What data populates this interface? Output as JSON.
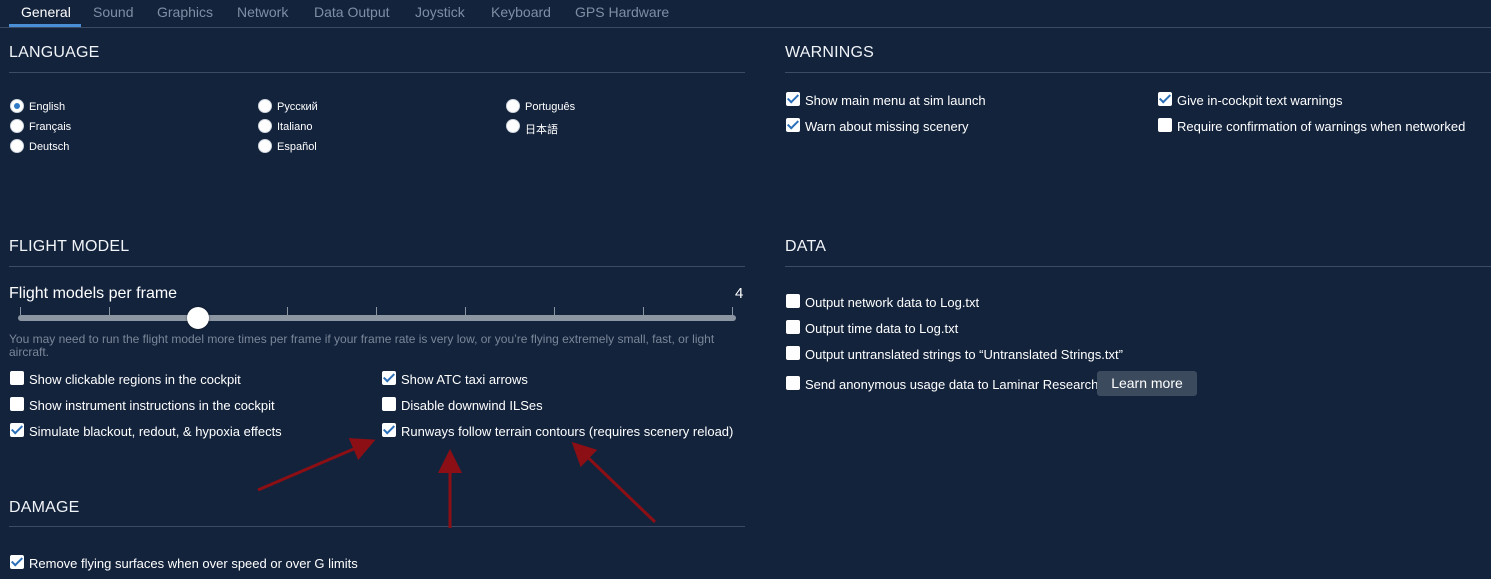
{
  "tabs": [
    "General",
    "Sound",
    "Graphics",
    "Network",
    "Data Output",
    "Joystick",
    "Keyboard",
    "GPS Hardware"
  ],
  "active_tab": "General",
  "language": {
    "title": "LANGUAGE",
    "options": [
      "English",
      "Français",
      "Deutsch",
      "Русский",
      "Italiano",
      "Español",
      "Português",
      "日本語"
    ],
    "selected": "English"
  },
  "warnings": {
    "title": "WARNINGS",
    "items": [
      {
        "label": "Show main menu at sim launch",
        "checked": true
      },
      {
        "label": "Warn about missing scenery",
        "checked": true
      },
      {
        "label": "Give in-cockpit text warnings",
        "checked": true
      },
      {
        "label": "Require confirmation of warnings when networked",
        "checked": false
      }
    ]
  },
  "flight_model": {
    "title": "FLIGHT MODEL",
    "slider_label": "Flight models per frame",
    "slider_value": "4",
    "slider_fraction": 0.25,
    "hint": "You may need to run the flight model more times per frame if your frame rate is very low, or you’re flying extremely small, fast, or light aircraft.",
    "items": [
      {
        "label": "Show clickable regions in the cockpit",
        "checked": false
      },
      {
        "label": "Show instrument instructions in the cockpit",
        "checked": false
      },
      {
        "label": "Simulate blackout, redout, & hypoxia effects",
        "checked": true
      },
      {
        "label": "Show ATC taxi arrows",
        "checked": true
      },
      {
        "label": "Disable downwind ILSes",
        "checked": false
      },
      {
        "label": "Runways follow terrain contours (requires scenery reload)",
        "checked": true
      }
    ]
  },
  "data": {
    "title": "DATA",
    "items": [
      {
        "label": "Output network data to Log.txt",
        "checked": false
      },
      {
        "label": "Output time data to Log.txt",
        "checked": false
      },
      {
        "label": "Output untranslated strings to “Untranslated Strings.txt”",
        "checked": false
      },
      {
        "label": "Send anonymous usage data to Laminar Research",
        "checked": false
      }
    ],
    "learn_more": "Learn more"
  },
  "damage": {
    "title": "DAMAGE",
    "items": [
      {
        "label": "Remove flying surfaces when over speed or over G limits",
        "checked": true
      }
    ]
  },
  "colors": {
    "background": "#13233c",
    "accent": "#4a8fd6",
    "annotation_arrow": "#8b0f14"
  }
}
